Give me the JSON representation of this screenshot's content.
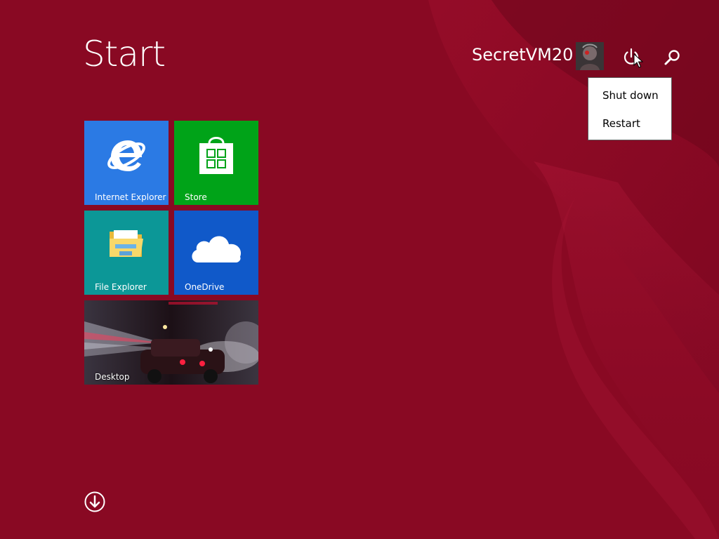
{
  "start": {
    "title": "Start"
  },
  "account": {
    "user_name": "SecretVM20",
    "avatar_icon": "user-avatar-icon"
  },
  "header_icons": {
    "power": "power-icon",
    "search": "search-icon"
  },
  "power_menu": {
    "items": [
      {
        "label": "Shut down"
      },
      {
        "label": "Restart"
      }
    ]
  },
  "tiles": [
    {
      "label": "Internet Explorer",
      "icon": "internet-explorer-icon",
      "color": "#2b7ae4"
    },
    {
      "label": "Store",
      "icon": "store-icon",
      "color": "#00a318"
    },
    {
      "label": "File Explorer",
      "icon": "file-explorer-icon",
      "color": "#0c9797"
    },
    {
      "label": "OneDrive",
      "icon": "onedrive-icon",
      "color": "#1059c9"
    },
    {
      "label": "Desktop",
      "icon": "desktop-wallpaper-image",
      "color": "#1a1418"
    }
  ],
  "footer": {
    "all_apps_icon": "down-arrow-circle-icon"
  },
  "colors": {
    "background": "#8f0a25",
    "menu_background": "#ffffff"
  }
}
